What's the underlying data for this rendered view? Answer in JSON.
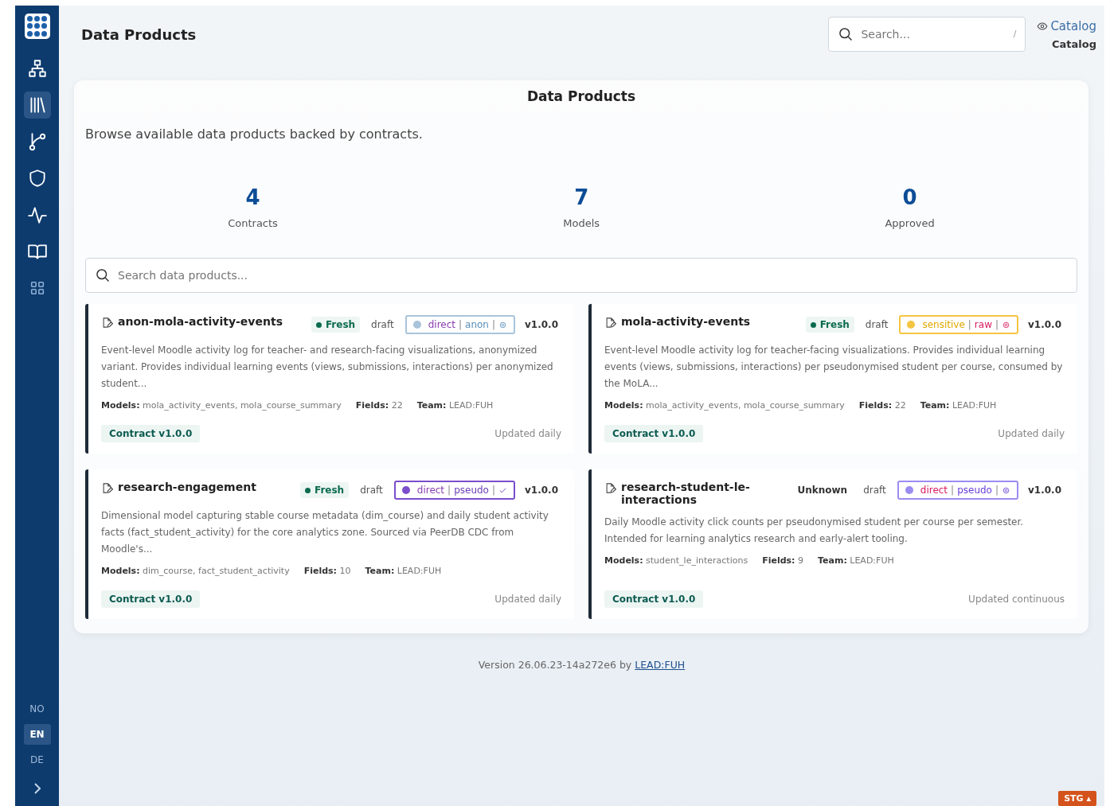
{
  "sidebar": {
    "nav": [
      {
        "selected": false
      },
      {
        "selected": true
      },
      {
        "selected": false
      },
      {
        "selected": false
      },
      {
        "selected": false
      },
      {
        "selected": false
      },
      {
        "selected": false
      }
    ],
    "languages": [
      {
        "label": "NO",
        "selected": false
      },
      {
        "label": "EN",
        "selected": true
      },
      {
        "label": "DE",
        "selected": false
      }
    ]
  },
  "header": {
    "title": "Data Products",
    "search": {
      "placeholder": "Search...",
      "shortcut": "/"
    },
    "view_link": "Catalog",
    "view_label": "Catalog"
  },
  "panel": {
    "title": "Data Products",
    "subtitle": "Browse available data products backed by contracts.",
    "stats": [
      {
        "value": "4",
        "label": "Contracts"
      },
      {
        "value": "7",
        "label": "Models"
      },
      {
        "value": "0",
        "label": "Approved"
      }
    ],
    "search": {
      "placeholder": "Search data products..."
    },
    "cards": [
      {
        "name": "anon-mola-activity-events",
        "freshness": {
          "kind": "fresh",
          "label": "Fresh"
        },
        "status": "draft",
        "classification": {
          "color": "#a9c4da",
          "separator": "|",
          "kind": "gear",
          "parts": [
            {
              "text": "direct",
              "color": "#8a3fb0"
            },
            {
              "text": "anon",
              "color": "#5a8fb8"
            }
          ]
        },
        "version": "v1.0.0",
        "description": "Event-level Moodle activity log for teacher- and research-facing visualizations, anonymized variant. Provides individual learning events (views, submissions, interactions) per anonymized student...",
        "meta": [
          "**Models:** mola_activity_events, mola_course_summary",
          "**Fields:** 22",
          "**Team:** LEAD:FUH"
        ],
        "contract": "Contract v1.0.0",
        "updated": "Updated daily"
      },
      {
        "name": "mola-activity-events",
        "freshness": {
          "kind": "fresh",
          "label": "Fresh"
        },
        "status": "draft",
        "classification": {
          "color": "#f5c542",
          "separator": "|",
          "kind": "gear",
          "parts": [
            {
              "text": "sensitive",
              "color": "#e0a800"
            },
            {
              "text": "raw",
              "color": "#d81b60"
            }
          ]
        },
        "version": "v1.0.0",
        "description": "Event-level Moodle activity log for teacher-facing visualizations. Provides individual learning events (views, submissions, interactions) per pseudonymised student per course, consumed by the MoLA...",
        "meta": [
          "**Models:** mola_activity_events, mola_course_summary",
          "**Fields:** 22",
          "**Team:** LEAD:FUH"
        ],
        "contract": "Contract v1.0.0",
        "updated": "Updated daily"
      },
      {
        "name": "research-engagement",
        "freshness": {
          "kind": "fresh",
          "label": "Fresh"
        },
        "status": "draft",
        "classification": {
          "color": "#7c4dcc",
          "separator": "|",
          "kind": "check",
          "parts": [
            {
              "text": "direct",
              "color": "#8a3fb0"
            },
            {
              "text": "pseudo",
              "color": "#6a3fb8"
            }
          ]
        },
        "version": "v1.0.0",
        "description": "Dimensional model capturing stable course metadata (dim_course) and daily student activity facts (fact_student_activity) for the core analytics zone. Sourced via PeerDB CDC from Moodle's...",
        "meta": [
          "**Models:** dim_course, fact_student_activity",
          "**Fields:** 10",
          "**Team:** LEAD:FUH"
        ],
        "contract": "Contract v1.0.0",
        "updated": "Updated daily"
      },
      {
        "name": "research-student-le-interactions",
        "freshness": {
          "kind": "unknown",
          "label": "Unknown"
        },
        "status": "draft",
        "classification": {
          "color": "#9b8cf0",
          "separator": "|",
          "kind": "gear",
          "parts": [
            {
              "text": "direct",
              "color": "#d81b60"
            },
            {
              "text": "pseudo",
              "color": "#6a3fd8"
            }
          ]
        },
        "version": "v1.0.0",
        "description": "Daily Moodle activity click counts per pseudonymised student per course per semester. Intended for learning analytics research and early-alert tooling.",
        "meta": [
          "**Models:** student_le_interactions",
          "**Fields:** 9",
          "**Team:** LEAD:FUH"
        ],
        "contract": "Contract v1.0.0",
        "updated": "Updated continuous"
      }
    ]
  },
  "footer": {
    "version": "Version 26.06.23-14a272e6 by",
    "link": "LEAD:FUH"
  },
  "env_badge": "STG ▴"
}
